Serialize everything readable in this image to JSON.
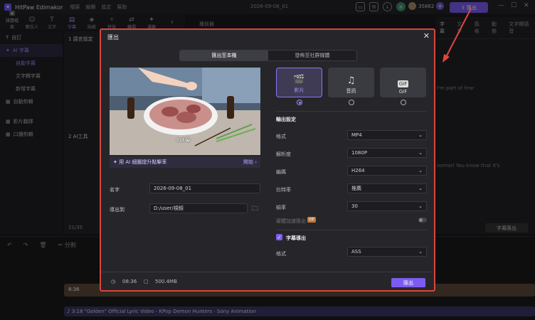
{
  "app": {
    "title": "HitPaw Edimakor",
    "menu": [
      "檔案",
      "編輯",
      "設定",
      "幫助"
    ],
    "project_date": "2026-09-08_01",
    "credits": "35862",
    "avatar_letter": "n",
    "export_label": "匯出"
  },
  "toolbar": {
    "items": [
      "媒體檔案",
      "數位人",
      "文字",
      "字幕",
      "貼紙",
      "特效",
      "轉場",
      "濾鏡"
    ],
    "active": "字幕"
  },
  "player_label": "播放器",
  "sidebar": {
    "items": [
      "自訂",
      "AI 字幕",
      "自動字幕",
      "文字轉字幕",
      "影片翻譯",
      "自動剪輯",
      "口播剪輯",
      "新增字幕"
    ]
  },
  "panel2": {
    "header": "1 語言設定",
    "header2": "2 AI工具",
    "bottom": "21/35"
  },
  "right_panel": {
    "tabs": [
      "字幕",
      "文字",
      "風格",
      "動態",
      "文字轉語音"
    ],
    "lines": [
      "I'm part of fear",
      "nomori You know that it's"
    ],
    "export_sub": "字幕匯出"
  },
  "timeline": {
    "split_label": "分割",
    "time_small": "8:36",
    "clip_text": "♪ 3:18 \"Golden\" Official Lyric Video - KPop Demon Hunters · Sony Animation"
  },
  "dialog": {
    "title": "匯出",
    "tabs": [
      "匯出至本機",
      "發佈至社群媒體"
    ],
    "preview_caption": "but😭",
    "ai_bar": {
      "label": "用 AI 細圖提升點擊率",
      "action": "開始"
    },
    "name_label": "名字",
    "name_value": "2026-09-08_01",
    "path_label": "導出到",
    "path_value": "D:/user/視頻",
    "formats": [
      {
        "label": "影片",
        "icon": "clapper-icon"
      },
      {
        "label": "音訊",
        "icon": "music-note-icon"
      },
      {
        "label": "GIF",
        "icon": "gif-icon"
      }
    ],
    "selected_format": "影片",
    "output_section": "輸出設定",
    "settings": [
      {
        "label": "格式",
        "value": "MP4"
      },
      {
        "label": "解析度",
        "value": "1080P"
      },
      {
        "label": "編碼",
        "value": "H264"
      },
      {
        "label": "比特率",
        "value": "推薦"
      },
      {
        "label": "幀率",
        "value": "30"
      }
    ],
    "hw_label": "硬體加速匯出",
    "hw_badge": "VIP",
    "subtitle_section": "字幕導出",
    "subtitle_format_label": "格式",
    "subtitle_format_value": "ASS",
    "duration": "08:36",
    "file_size": "500.4MB",
    "export_button": "匯出"
  },
  "colors": {
    "accent": "#7c5cf0",
    "highlight_border": "#d9453d"
  }
}
